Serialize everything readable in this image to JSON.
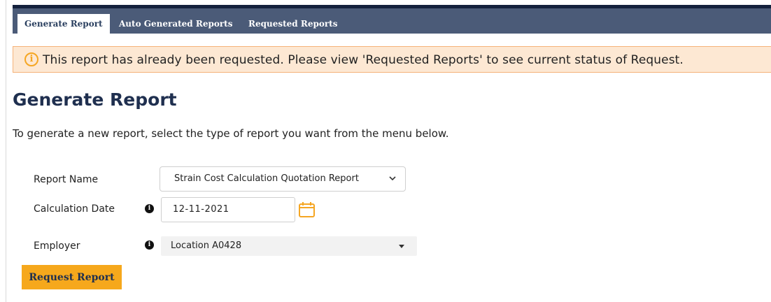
{
  "tabs": [
    {
      "label": "Generate Report",
      "active": true
    },
    {
      "label": "Auto Generated Reports",
      "active": false
    },
    {
      "label": "Requested Reports",
      "active": false
    }
  ],
  "alert": {
    "icon": "info-circle-icon",
    "text": "This report has already been requested. Please view 'Requested Reports' to see current status of Request.",
    "color": "#fde8d3"
  },
  "page": {
    "title": "Generate Report",
    "intro": "To generate a new report, select the type of report you want from the menu below."
  },
  "form": {
    "report_name": {
      "label": "Report Name",
      "value": "Strain Cost Calculation Quotation Report"
    },
    "calculation_date": {
      "label": "Calculation Date",
      "value": "12-11-2021"
    },
    "employer": {
      "label": "Employer",
      "value": "Location A0428"
    }
  },
  "actions": {
    "request_label": "Request Report"
  },
  "colors": {
    "nav": "#4b5b78",
    "accent": "#f6a81c",
    "heading": "#1f2f4f"
  }
}
